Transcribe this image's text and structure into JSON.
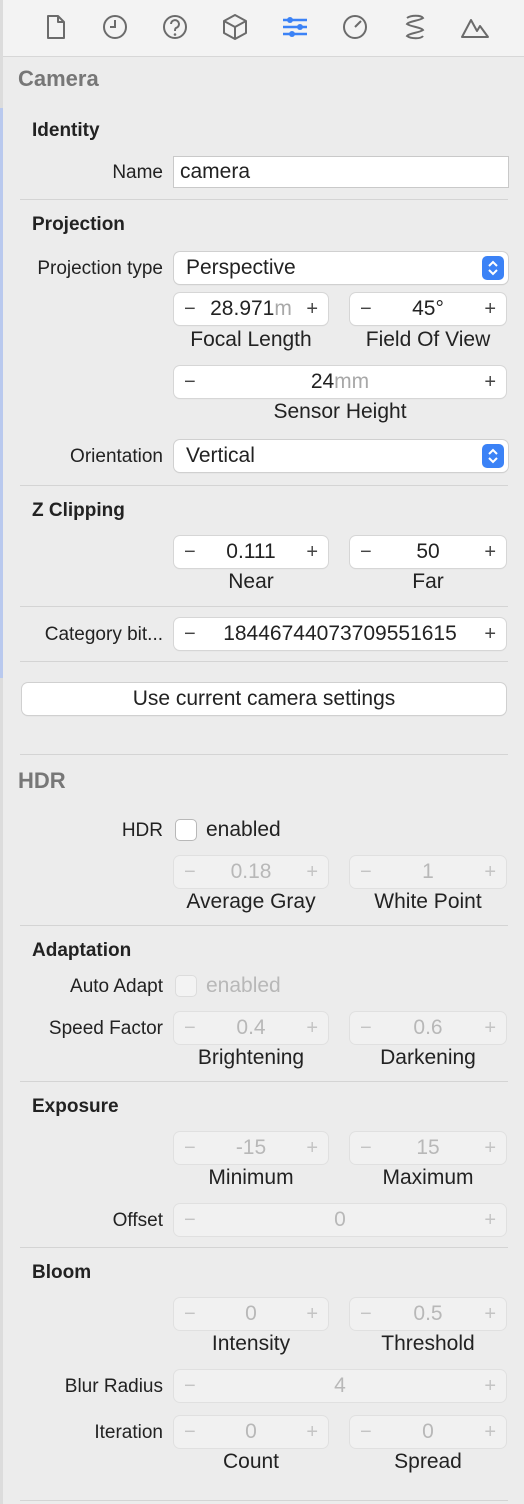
{
  "toolbar": {
    "icons": [
      "document-icon",
      "clock-icon",
      "help-icon",
      "cube-icon",
      "sliders-icon",
      "gauge-icon",
      "spring-icon",
      "mountain-icon"
    ],
    "accent": "#3b82f6"
  },
  "camera": {
    "title": "Camera",
    "identity": {
      "heading": "Identity",
      "name_label": "Name",
      "name_value": "camera"
    },
    "projection": {
      "heading": "Projection",
      "type_label": "Projection type",
      "type_value": "Perspective",
      "focal_length": {
        "value": "28.971",
        "unit": "m",
        "caption": "Focal Length"
      },
      "field_of_view": {
        "value": "45°",
        "caption": "Field Of View"
      },
      "sensor_height": {
        "value": "24",
        "unit": "mm",
        "caption": "Sensor Height"
      },
      "orientation_label": "Orientation",
      "orientation_value": "Vertical"
    },
    "z_clipping": {
      "heading": "Z Clipping",
      "near": {
        "value": "0.111",
        "caption": "Near"
      },
      "far": {
        "value": "50",
        "caption": "Far"
      }
    },
    "category_label": "Category bit...",
    "category_value": "18446744073709551615",
    "use_current_button": "Use current camera settings"
  },
  "hdr": {
    "title": "HDR",
    "hdr_label": "HDR",
    "enabled_label": "enabled",
    "average_gray": {
      "value": "0.18",
      "caption": "Average Gray"
    },
    "white_point": {
      "value": "1",
      "caption": "White Point"
    },
    "adaptation": {
      "heading": "Adaptation",
      "auto_adapt_label": "Auto Adapt",
      "enabled_label": "enabled",
      "speed_factor_label": "Speed Factor",
      "brightening": {
        "value": "0.4",
        "caption": "Brightening"
      },
      "darkening": {
        "value": "0.6",
        "caption": "Darkening"
      }
    },
    "exposure": {
      "heading": "Exposure",
      "minimum": {
        "value": "-15",
        "caption": "Minimum"
      },
      "maximum": {
        "value": "15",
        "caption": "Maximum"
      },
      "offset_label": "Offset",
      "offset_value": "0"
    },
    "bloom": {
      "heading": "Bloom",
      "intensity": {
        "value": "0",
        "caption": "Intensity"
      },
      "threshold": {
        "value": "0.5",
        "caption": "Threshold"
      },
      "blur_radius_label": "Blur Radius",
      "blur_radius_value": "4",
      "iteration_label": "Iteration",
      "count": {
        "value": "0",
        "caption": "Count"
      },
      "spread": {
        "value": "0",
        "caption": "Spread"
      }
    }
  },
  "stepper_symbols": {
    "minus": "−",
    "plus": "+"
  }
}
